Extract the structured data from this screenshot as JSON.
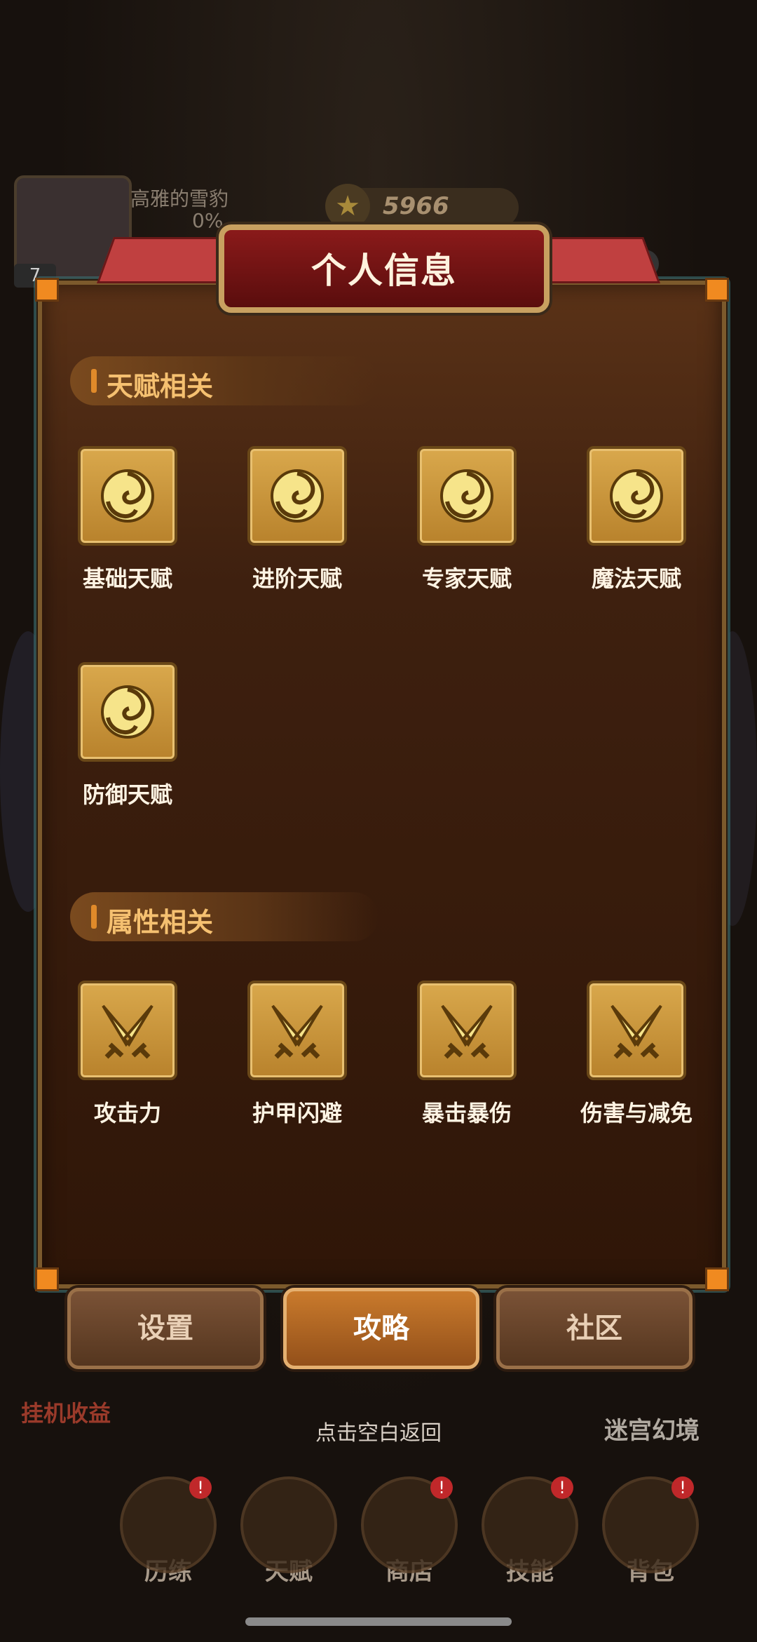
{
  "player": {
    "name": "高雅的雪豹",
    "progress": "0%",
    "level": "7"
  },
  "currency": {
    "value": "5966"
  },
  "panel": {
    "title": "个人信息",
    "talent_section": {
      "label": "天赋相关",
      "items": [
        {
          "label": "基础天赋",
          "icon": "swirl-icon"
        },
        {
          "label": "进阶天赋",
          "icon": "swirl-icon"
        },
        {
          "label": "专家天赋",
          "icon": "swirl-icon"
        },
        {
          "label": "魔法天赋",
          "icon": "swirl-icon"
        },
        {
          "label": "防御天赋",
          "icon": "swirl-icon"
        }
      ]
    },
    "attribute_section": {
      "label": "属性相关",
      "items": [
        {
          "label": "攻击力",
          "icon": "crossed-swords-icon"
        },
        {
          "label": "护甲闪避",
          "icon": "crossed-swords-icon"
        },
        {
          "label": "暴击暴伤",
          "icon": "crossed-swords-icon"
        },
        {
          "label": "伤害与减免",
          "icon": "crossed-swords-icon"
        }
      ]
    }
  },
  "buttons": {
    "settings": "设置",
    "guide": "攻略",
    "community": "社区"
  },
  "hint": "点击空白返回",
  "background": {
    "idle_income": "挂机收益",
    "maze": "迷宫幻境",
    "nav": [
      {
        "label": "历练",
        "badge": "!"
      },
      {
        "label": "天赋",
        "badge": ""
      },
      {
        "label": "商店",
        "badge": "!"
      },
      {
        "label": "技能",
        "badge": "!"
      },
      {
        "label": "背包",
        "badge": "!"
      }
    ]
  },
  "colors": {
    "accent": "#e08a2a",
    "tile": "#d9a84c",
    "title_bg": "#8a1a1a"
  }
}
